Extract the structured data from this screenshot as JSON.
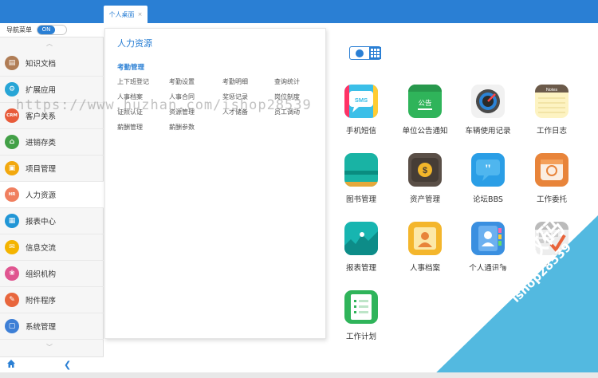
{
  "tabs": [
    {
      "label": "个人桌面",
      "close": "×"
    }
  ],
  "nav": {
    "title": "导航菜单",
    "toggle_label": "ON"
  },
  "sidebar": {
    "items": [
      {
        "label": "知识文档",
        "icon": "book-icon",
        "color": "#b07d56"
      },
      {
        "label": "扩展应用",
        "icon": "extension-icon",
        "color": "#27a5d6"
      },
      {
        "label": "客户关系",
        "icon": "crm-icon",
        "color": "#e85b3a"
      },
      {
        "label": "进销存类",
        "icon": "inventory-icon",
        "color": "#43a047"
      },
      {
        "label": "项目管理",
        "icon": "project-icon",
        "color": "#f2a80e"
      },
      {
        "label": "人力资源",
        "icon": "hr-icon",
        "color": "#f07f5f"
      },
      {
        "label": "报表中心",
        "icon": "report-icon",
        "color": "#2196d6"
      },
      {
        "label": "信息交流",
        "icon": "message-icon",
        "color": "#f4b400"
      },
      {
        "label": "组织机构",
        "icon": "org-icon",
        "color": "#e05590"
      },
      {
        "label": "附件程序",
        "icon": "attachment-icon",
        "color": "#e8663d"
      },
      {
        "label": "系统管理",
        "icon": "system-icon",
        "color": "#3d7fd6"
      }
    ]
  },
  "popup": {
    "title": "人力资源",
    "category": "考勤管理",
    "links": [
      "上下班登记",
      "考勤设置",
      "考勤明细",
      "查询统计",
      "人事档案",
      "人事合同",
      "奖惩记录",
      "岗位制度",
      "证照认证",
      "资源管理",
      "人才储备",
      "员工调动",
      "薪酬管理",
      "薪酬参数"
    ]
  },
  "apps": [
    {
      "label": "手机短信",
      "icon": "sms-icon"
    },
    {
      "label": "单位公告通知",
      "icon": "notice-icon"
    },
    {
      "label": "车辆使用记录",
      "icon": "vehicle-icon"
    },
    {
      "label": "工作日志",
      "icon": "notes-icon"
    },
    {
      "label": "图书管理",
      "icon": "library-icon"
    },
    {
      "label": "资产管理",
      "icon": "asset-icon"
    },
    {
      "label": "论坛BBS",
      "icon": "bbs-icon"
    },
    {
      "label": "工作委托",
      "icon": "delegate-icon"
    },
    {
      "label": "报表管理",
      "icon": "report-chart-icon"
    },
    {
      "label": "人事档案",
      "icon": "personnel-file-icon"
    },
    {
      "label": "个人通讯簿",
      "icon": "contacts-icon"
    },
    {
      "label": "考勤",
      "icon": "attendance-icon"
    },
    {
      "label": "工作计划",
      "icon": "plan-icon"
    }
  ],
  "app_tile_texts": {
    "sms": "SMS",
    "notice": "公告",
    "notes": "Notes"
  },
  "watermark": {
    "url": "https://www.huzhan.com/ishop28539",
    "brand": "蓝猫数码",
    "shop": "ishop28539"
  },
  "colors": {
    "accent": "#2a7fd4",
    "corner": "#53b9e0"
  }
}
